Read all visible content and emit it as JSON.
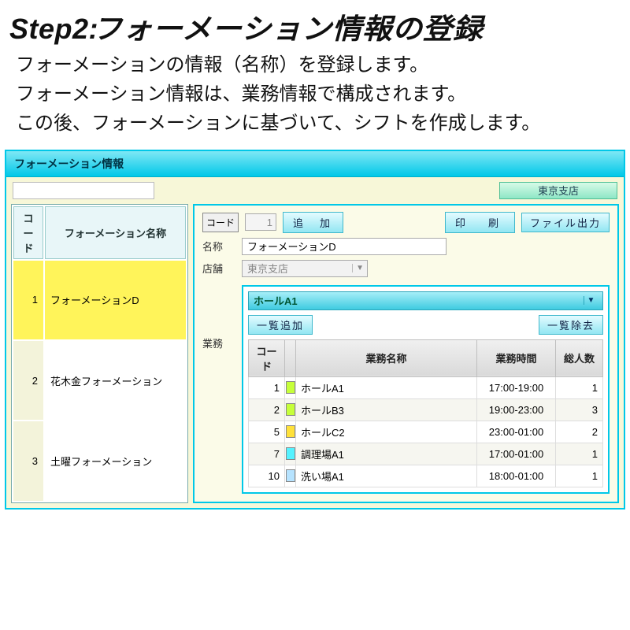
{
  "heading": {
    "step_prefix": "Step2:",
    "title": "フォーメーション情報の登録",
    "intro_lines": [
      "フォーメーションの情報（名称）を登録します。",
      "フォーメーション情報は、業務情報で構成されます。",
      "この後、フォーメーションに基づいて、シフトを作成します。"
    ]
  },
  "app": {
    "window_title": "フォーメーション情報",
    "branch": "東京支店"
  },
  "left": {
    "col_code": "コード",
    "col_name": "フォーメーション名称",
    "rows": [
      {
        "code": "1",
        "name": "フォーメーションD",
        "selected": true
      },
      {
        "code": "2",
        "name": "花木金フォーメーション",
        "selected": false
      },
      {
        "code": "3",
        "name": "土曜フォーメーション",
        "selected": false
      }
    ]
  },
  "right": {
    "code_label": "コード",
    "code_value": "1",
    "add_btn": "追　加",
    "print_btn": "印　刷",
    "export_btn": "ファイル出力",
    "name_label": "名称",
    "name_value": "フォーメーションD",
    "store_label": "店舗",
    "store_value": "東京支店",
    "task_label": "業務",
    "hall_select": "ホールA1",
    "list_add_btn": "一覧追加",
    "list_remove_btn": "一覧除去",
    "task_cols": {
      "code": "コード",
      "name": "業務名称",
      "time": "業務時間",
      "count": "総人数"
    },
    "tasks": [
      {
        "code": "1",
        "color": "#c6ff3a",
        "name": "ホールA1",
        "time": "17:00-19:00",
        "count": "1"
      },
      {
        "code": "2",
        "color": "#c6ff3a",
        "name": "ホールB3",
        "time": "19:00-23:00",
        "count": "3"
      },
      {
        "code": "5",
        "color": "#ffe13a",
        "name": "ホールC2",
        "time": "23:00-01:00",
        "count": "2"
      },
      {
        "code": "7",
        "color": "#55f2ff",
        "name": "調理場A1",
        "time": "17:00-01:00",
        "count": "1"
      },
      {
        "code": "10",
        "color": "#b6e3ff",
        "name": "洗い場A1",
        "time": "18:00-01:00",
        "count": "1"
      }
    ]
  }
}
